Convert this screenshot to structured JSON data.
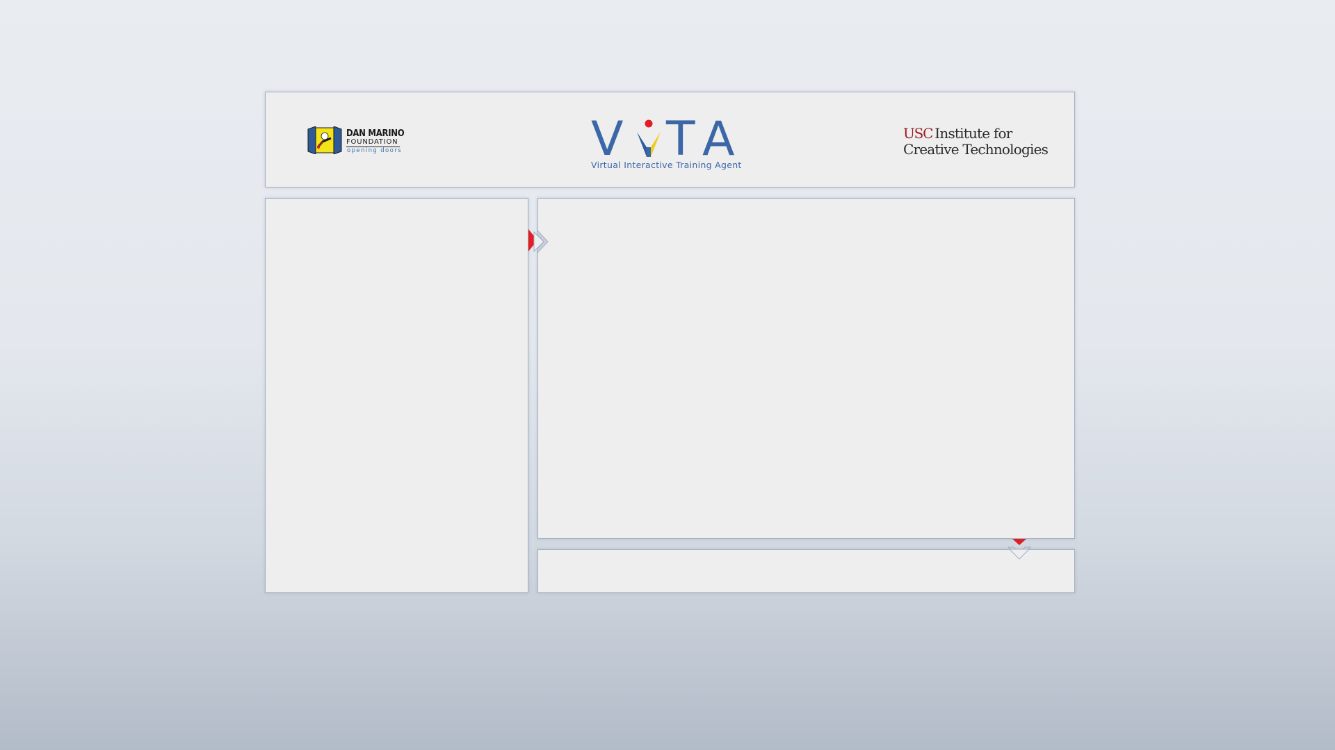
{
  "header": {
    "left_logo": {
      "icon": "open-door-icon",
      "name": "DAN MARINO",
      "org": "FOUNDATION",
      "tagline": "opening doors"
    },
    "center_logo": {
      "letters": [
        "V",
        "I",
        "T",
        "A"
      ],
      "subtitle": "Virtual  Interactive  Training  Agent"
    },
    "right_logo": {
      "usc": "USC",
      "line1": "Institute for",
      "line2": "Creative Technologies"
    }
  },
  "colors": {
    "accent_red": "#e31d25",
    "vita_blue": "#3c67a7",
    "usc_cardinal": "#991b1e",
    "panel_bg": "#eeeeef",
    "panel_border": "#a3afc4"
  },
  "panels": {
    "left": "",
    "main": "",
    "bottom": ""
  },
  "connectors": {
    "left_to_main": "chevron-right-icon",
    "main_to_bottom": "chevron-down-icon"
  }
}
